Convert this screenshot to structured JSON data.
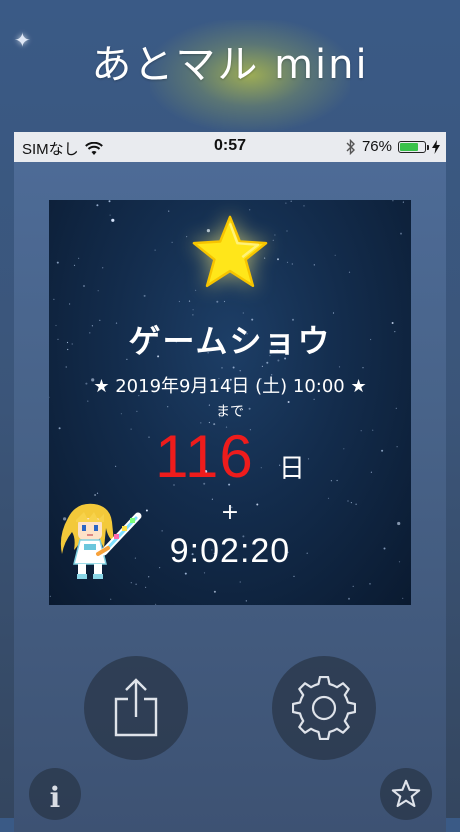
{
  "app": {
    "title": "あとマル mini"
  },
  "status_bar": {
    "carrier": "SIMなし",
    "time": "0:57",
    "battery": "76%",
    "battery_level": 0.76
  },
  "card": {
    "event_name": "ゲームショウ",
    "event_date": "★ 2019年9月14日 (土) 10:00 ★",
    "until_label": "まで",
    "days_value": "116",
    "days_unit": "日",
    "plus": "+",
    "time_left": "9:02:20"
  },
  "colors": {
    "days_accent": "#ee1c1c",
    "star": "#ffe61a",
    "battery": "#39c24a"
  },
  "icons": {
    "share": "share-icon",
    "settings": "gear-icon",
    "info": "info-icon",
    "favorite": "star-outline-icon",
    "wifi": "wifi-icon",
    "bluetooth": "bluetooth-icon",
    "charging": "charging-icon"
  },
  "buttons": {
    "info_glyph": "i"
  }
}
